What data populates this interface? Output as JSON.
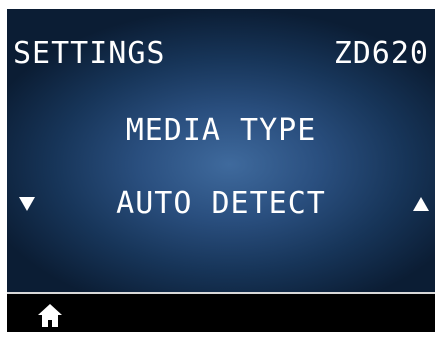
{
  "header": {
    "title": "SETTINGS",
    "model": "ZD620"
  },
  "setting": {
    "name": "MEDIA TYPE",
    "value": "AUTO DETECT"
  },
  "navigation": {
    "previous_icon": "triangle-down-icon",
    "next_icon": "triangle-up-icon",
    "home_icon": "home-icon"
  },
  "colors": {
    "text": "#ffffff",
    "background_center": "#3f6a9d",
    "background_edge": "#0b1d34",
    "bottom_bar": "#000000",
    "divider": "#d8d8d8"
  }
}
